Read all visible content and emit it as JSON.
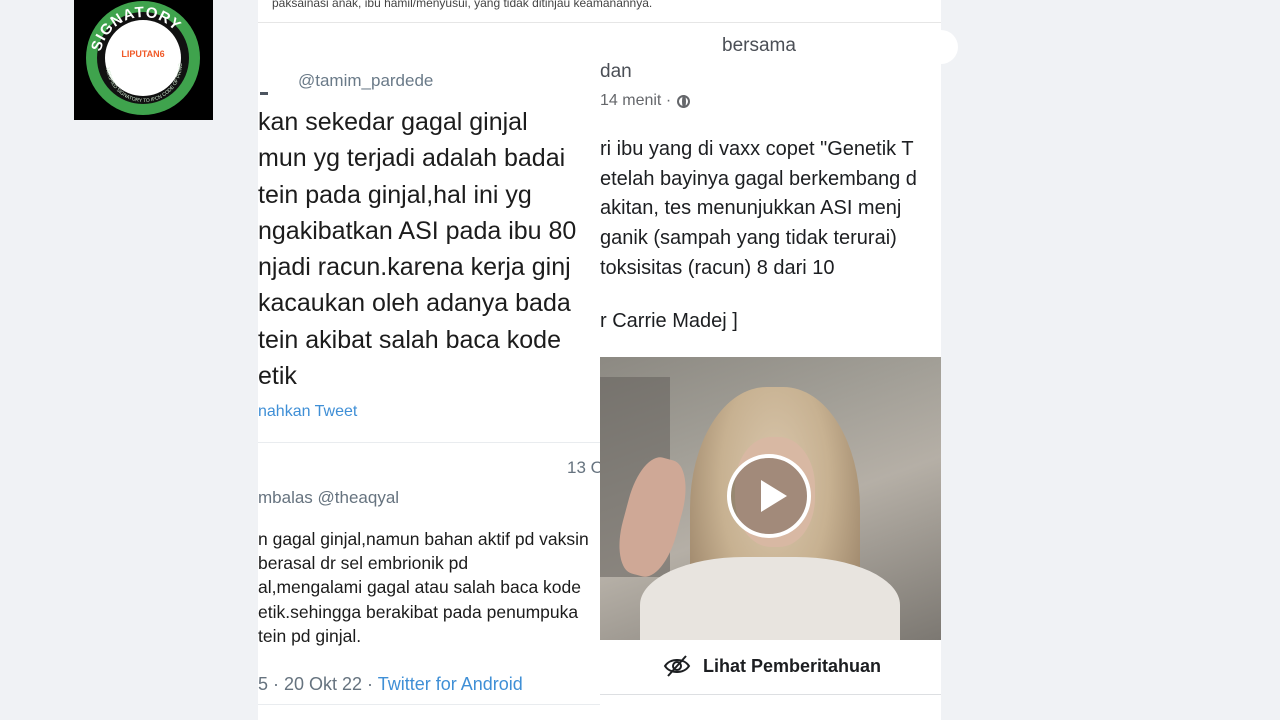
{
  "badge": {
    "word": "SIGNATORY",
    "logo_text": "LIPUTAN6",
    "ring_text": "VERIFIED SIGNATORY TO IFCN CODE OF PRINCIPLES",
    "colors": {
      "ring": "#3fa34d",
      "inner": "#ffffff",
      "logo": "#f05a28"
    }
  },
  "top_strip": "paksainasi anak, ibu hamil/menyusui, yang tidak ditinjau keamanannya.",
  "tweet": {
    "handle": "@tamim_pardede",
    "body_lines": [
      "kan sekedar gagal ginjal",
      "mun yg terjadi adalah badai",
      "tein pada ginjal,hal ini yg",
      "ngakibatkan ASI pada ibu 80",
      "njadi racun.karena kerja ginj",
      "kacaukan oleh adanya bada",
      "tein akibat salah baca kode",
      "etik"
    ],
    "translate_label": "nahkan Tweet",
    "reply_date": "13 O",
    "reply_to": "mbalas @theaqyal",
    "reply_lines": [
      "n gagal ginjal,namun bahan aktif pd vaksin",
      "berasal dr sel embrionik pd",
      "al,mengalami gagal atau salah baca kode",
      "etik.sehingga berakibat pada penumpuka",
      "tein pd ginjal."
    ],
    "footer_time": "5 · 20 Okt 22 · ",
    "footer_source": "Twitter for Android"
  },
  "facebook": {
    "with_text": "bersama",
    "dan_text": "dan",
    "time": "14 menit ·",
    "post_lines": [
      "ri ibu yang di vaxx copet \"Genetik T",
      "etelah bayinya gagal berkembang d",
      "akitan, tes menunjukkan ASI menj",
      "ganik (sampah yang tidak terurai)",
      " toksisitas (racun) 8 dari 10"
    ],
    "credit": "r Carrie Madej ]",
    "notice_label": "Lihat Pemberitahuan"
  }
}
